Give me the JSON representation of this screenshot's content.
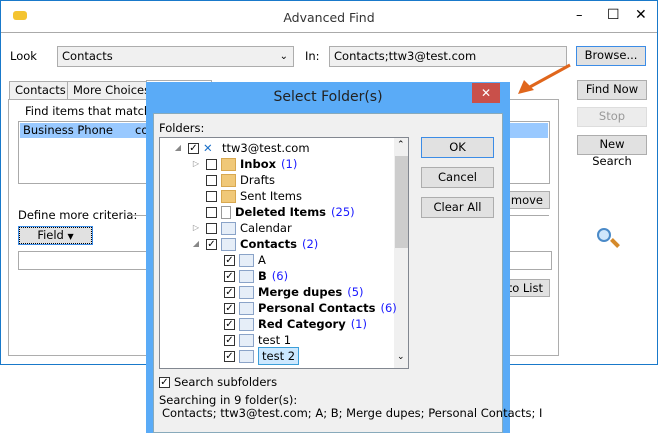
{
  "window": {
    "title": "Advanced Find",
    "minimize": "–",
    "maximize": "☐",
    "close": "✕"
  },
  "look": {
    "label": "Look",
    "value": "Contacts"
  },
  "in": {
    "label": "In:",
    "value": "Contacts;ttw3@test.com"
  },
  "buttons": {
    "browse": "Browse...",
    "find_now": "Find Now",
    "stop": "Stop",
    "new_search": "New Search",
    "remove": "move",
    "add_to_list": "to List"
  },
  "tabs": [
    "Contacts",
    "More Choices"
  ],
  "panel": {
    "find_text": "Find items that match th",
    "list_row": {
      "field": "Business Phone",
      "cond": "co"
    },
    "define": "Define more criteria:",
    "field_button": "Field"
  },
  "dialog": {
    "title": "Select Folder(s)",
    "close": "✕",
    "folders_label": "Folders:",
    "ok": "OK",
    "cancel": "Cancel",
    "clear_all": "Clear All",
    "tree": [
      {
        "label": "ttw3@test.com",
        "checked": true,
        "level": 0,
        "expander": "open",
        "icon": "exchange",
        "bold": false,
        "count": ""
      },
      {
        "label": "Inbox",
        "checked": false,
        "level": 1,
        "expander": "closed",
        "icon": "inbox",
        "bold": true,
        "count": "(1)"
      },
      {
        "label": "Drafts",
        "checked": false,
        "level": 1,
        "expander": "",
        "icon": "drafts",
        "bold": false,
        "count": ""
      },
      {
        "label": "Sent Items",
        "checked": false,
        "level": 1,
        "expander": "",
        "icon": "sent",
        "bold": false,
        "count": ""
      },
      {
        "label": "Deleted Items",
        "checked": false,
        "level": 1,
        "expander": "",
        "icon": "trash",
        "bold": true,
        "count": "(25)"
      },
      {
        "label": "Calendar",
        "checked": false,
        "level": 1,
        "expander": "closed",
        "icon": "calendar",
        "bold": false,
        "count": ""
      },
      {
        "label": "Contacts",
        "checked": true,
        "level": 1,
        "expander": "open",
        "icon": "contacts",
        "bold": true,
        "count": "(2)"
      },
      {
        "label": "A",
        "checked": true,
        "level": 2,
        "expander": "",
        "icon": "contacts",
        "bold": false,
        "count": ""
      },
      {
        "label": "B",
        "checked": true,
        "level": 2,
        "expander": "",
        "icon": "contacts",
        "bold": true,
        "count": "(6)"
      },
      {
        "label": "Merge dupes",
        "checked": true,
        "level": 2,
        "expander": "",
        "icon": "contacts",
        "bold": true,
        "count": "(5)"
      },
      {
        "label": "Personal Contacts",
        "checked": true,
        "level": 2,
        "expander": "",
        "icon": "contacts",
        "bold": true,
        "count": "(6)"
      },
      {
        "label": "Red Category",
        "checked": true,
        "level": 2,
        "expander": "",
        "icon": "contacts",
        "bold": true,
        "count": "(1)"
      },
      {
        "label": "test 1",
        "checked": true,
        "level": 2,
        "expander": "",
        "icon": "contacts",
        "bold": false,
        "count": ""
      },
      {
        "label": "test 2",
        "checked": true,
        "level": 2,
        "expander": "",
        "icon": "contacts",
        "bold": false,
        "count": "",
        "selected": true
      }
    ],
    "search_subfolders": "Search subfolders",
    "searching": "Searching in 9 folder(s):",
    "folder_list": "Contacts; ttw3@test.com; A; B; Merge dupes; Personal Contacts; I"
  },
  "colors": {
    "accent": "#5aabf7",
    "close": "#c9504a",
    "arrow": "#e0661c",
    "selection": "#99c9ff"
  }
}
